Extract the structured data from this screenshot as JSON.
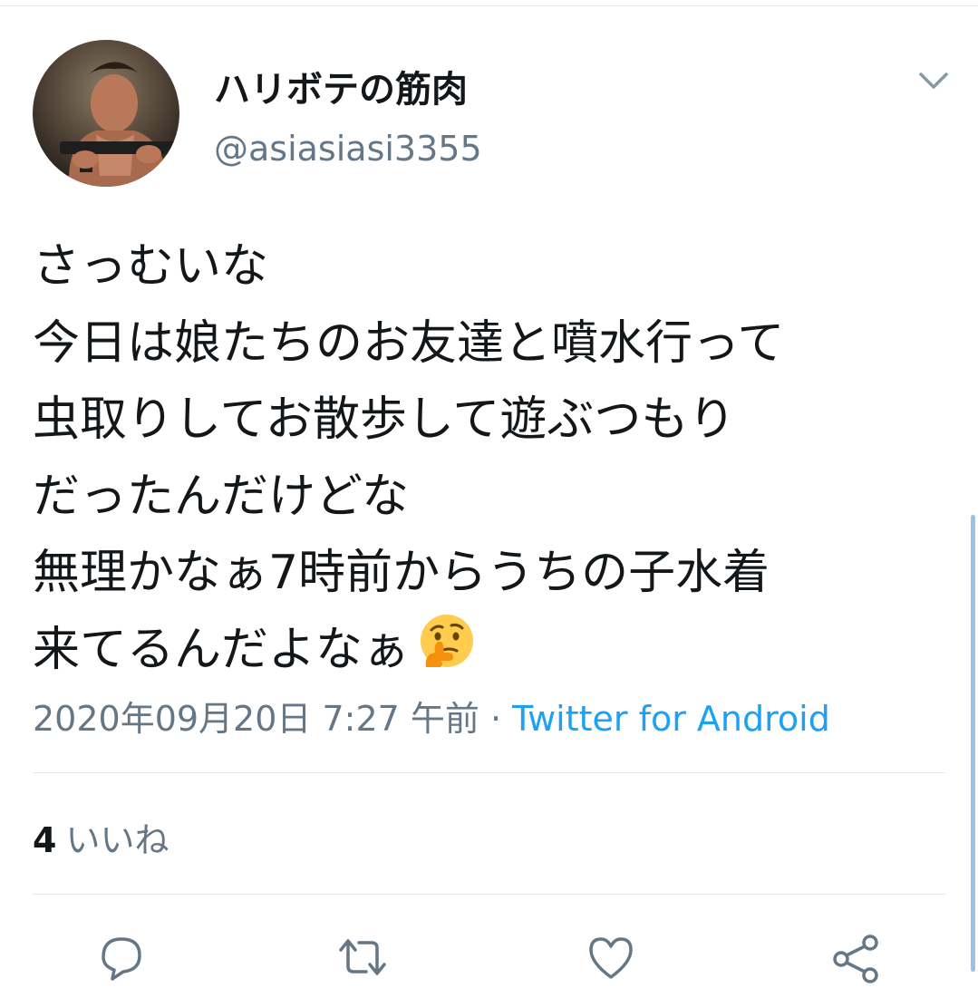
{
  "user": {
    "display_name": "ハリボテの筋肉",
    "handle": "@asiasiasi3355"
  },
  "tweet": {
    "lines": [
      "さっむいな",
      "今日は娘たちのお友達と噴水行って",
      "虫取りしてお散歩して遊ぶつもり",
      "だったんだけどな",
      "無理かなぁ7時前からうちの子水着",
      "来てるんだよなぁ"
    ],
    "emoji": "thinking-face-icon",
    "timestamp": "2020年09月20日 7:27 午前",
    "separator": " · ",
    "source": "Twitter for Android"
  },
  "stats": {
    "likes_count": "4",
    "likes_label": "いいね"
  },
  "actions": [
    "reply-icon",
    "retweet-icon",
    "like-icon",
    "share-icon"
  ],
  "colors": {
    "text": "#14171a",
    "secondary": "#657786",
    "link": "#1da1f2",
    "divider": "#e1e8ed"
  }
}
